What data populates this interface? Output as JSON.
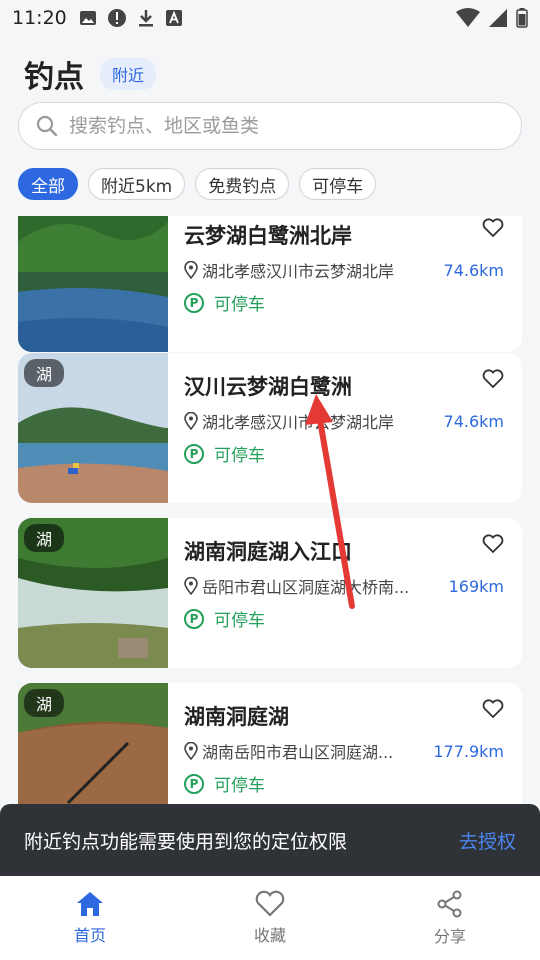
{
  "status_bar": {
    "time": "11:20"
  },
  "header": {
    "title": "钓点",
    "badge": "附近"
  },
  "search": {
    "placeholder": "搜索钓点、地区或鱼类"
  },
  "chips": [
    "全部",
    "附近5km",
    "免费钓点",
    "可停车"
  ],
  "spots": [
    {
      "name": "云梦湖白鹭洲北岸",
      "tag": "",
      "address": "湖北孝感汉川市云梦湖北岸",
      "distance": "74.6km",
      "parking": "可停车"
    },
    {
      "name": "汉川云梦湖白鹭洲",
      "tag": "湖",
      "address": "湖北孝感汉川市云梦湖北岸",
      "distance": "74.6km",
      "parking": "可停车"
    },
    {
      "name": "湖南洞庭湖入江口",
      "tag": "湖",
      "address": "岳阳市君山区洞庭湖大桥南...",
      "distance": "169km",
      "parking": "可停车"
    },
    {
      "name": "湖南洞庭湖",
      "tag": "湖",
      "address": "湖南岳阳市君山区洞庭湖...",
      "distance": "177.9km",
      "parking": "可停车"
    }
  ],
  "toast": {
    "message": "附近钓点功能需要使用到您的定位权限",
    "action": "去授权"
  },
  "nav": [
    {
      "label": "首页",
      "icon": "home-icon",
      "active": true
    },
    {
      "label": "收藏",
      "icon": "heart-icon",
      "active": false
    },
    {
      "label": "分享",
      "icon": "share-icon",
      "active": false
    }
  ],
  "colors": {
    "accent": "#2e68e0",
    "parking": "#23a05a",
    "arrow": "#e53935"
  }
}
